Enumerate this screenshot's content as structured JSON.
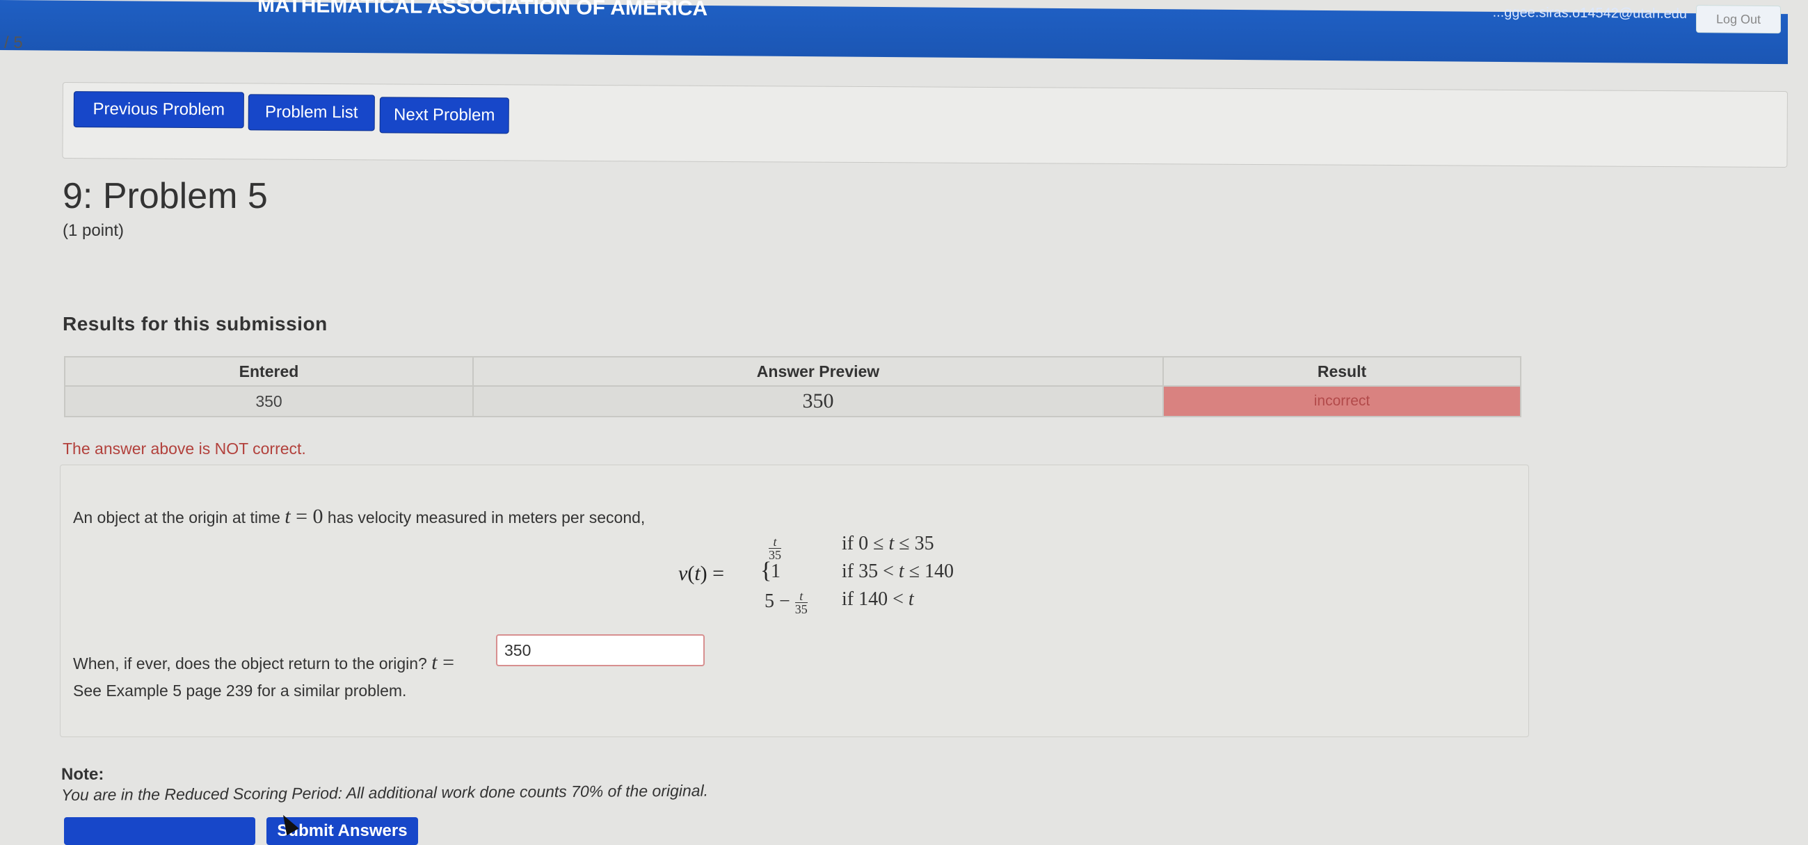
{
  "header": {
    "org": "MATHEMATICAL ASSOCIATION OF AMERICA",
    "user": "...ggee.siras.o14542@utah.edu",
    "logout": "Log Out"
  },
  "page_indicator": "/ 5",
  "nav": {
    "prev": "Previous Problem",
    "list": "Problem List",
    "next": "Next Problem"
  },
  "problem": {
    "title": "9: Problem 5",
    "points": "(1 point)"
  },
  "results": {
    "heading": "Results for this submission",
    "columns": [
      "Entered",
      "Answer Preview",
      "Result"
    ],
    "row": {
      "entered": "350",
      "preview": "350",
      "result": "incorrect"
    },
    "status_message": "The answer above is NOT correct."
  },
  "statement": {
    "intro_a": "An object at the origin at time",
    "intro_var": "t",
    "intro_eq": " = 0",
    "intro_b": " has velocity measured in meters per second,",
    "lhs": "v(t) = ",
    "cases": [
      {
        "expr": "t/35",
        "cond": "if 0 ≤ t ≤ 35"
      },
      {
        "expr": "1",
        "cond": "if 35 < t ≤ 140"
      },
      {
        "expr": "5 − t/35",
        "cond": "if 140 < t"
      }
    ],
    "question": "When, if ever, does the object return to the origin?",
    "question_var": "t",
    "question_eq": " = ",
    "answer_value": "350",
    "example": "See Example 5 page 239 for a similar problem."
  },
  "note": {
    "heading": "Note:",
    "text": "You are in the Reduced Scoring Period: All additional work done counts 70% of the original."
  },
  "actions": {
    "submit": "Submit Answers"
  },
  "colors": {
    "nav_button": "#1747c9",
    "header_bar": "#1f5fc3",
    "incorrect_cell": "#d98280",
    "error_text": "#b2413c"
  }
}
